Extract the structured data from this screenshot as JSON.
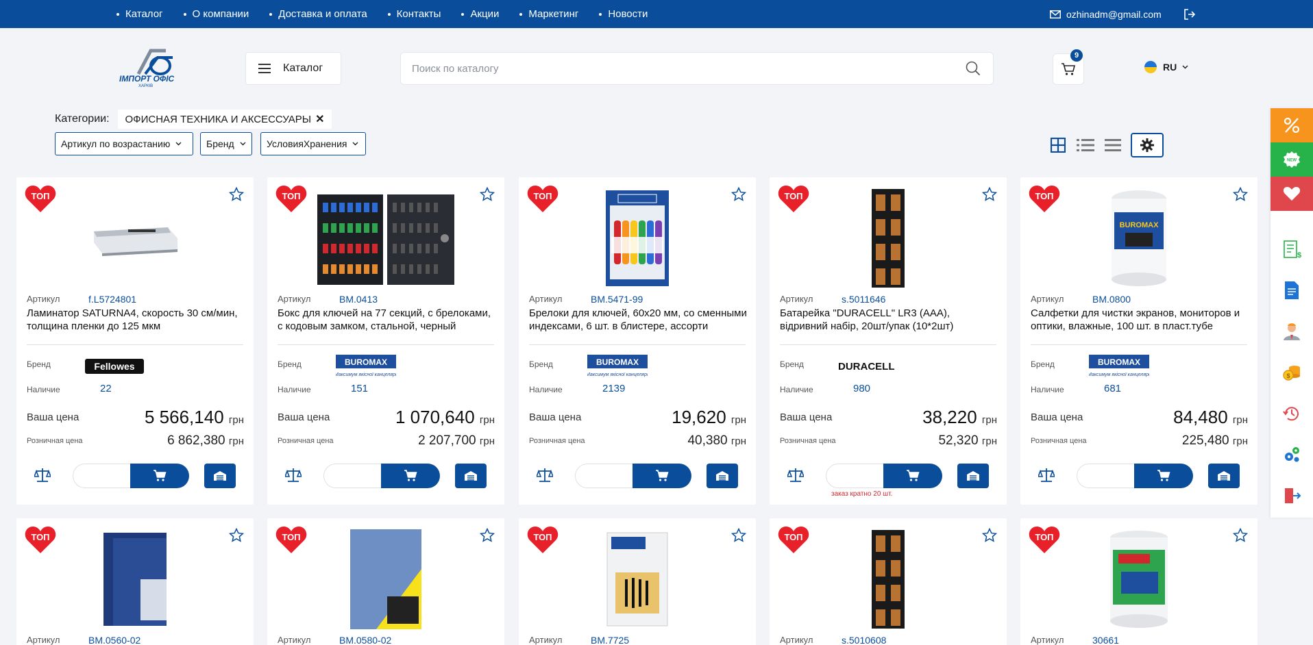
{
  "topnav": {
    "items": [
      "Каталог",
      "О компании",
      "Доставка и оплата",
      "Контакты",
      "Акции",
      "Маркетинг",
      "Новости"
    ],
    "email": "ozhinadm@gmail.com"
  },
  "header": {
    "catalog_label": "Каталог",
    "search_placeholder": "Поиск по каталогу",
    "cart_count": "9",
    "lang": "RU"
  },
  "filters": {
    "categories_label": "Категории:",
    "category_chip": "ОФИСНАЯ ТЕХНИКА И АКСЕССУАРЫ",
    "sort": "Артикул по возрастанию",
    "brand": "Бренд",
    "storage": "УсловияХранения"
  },
  "labels": {
    "top": "ТОП",
    "article": "Артикул",
    "brand": "Бренд",
    "stock": "Наличие",
    "your_price": "Ваша цена",
    "retail_price": "Розничная цена",
    "currency": "грн"
  },
  "products": [
    {
      "article": "f.L5724801",
      "title": "Ламинатор SATURNA4, скорость 30 см/мин, толщина пленки до 125 мкм",
      "brand": "Fellowes",
      "stock": "22",
      "price": "5 566,140",
      "retail": "6 862,380"
    },
    {
      "article": "BM.0413",
      "title": "Бокс для ключей на 77 секций, с брелоками, с кодовым замком, стальной, черный",
      "brand": "BUROMAX",
      "stock": "151",
      "price": "1 070,640",
      "retail": "2 207,700"
    },
    {
      "article": "BM.5471-99",
      "title": "Брелоки для ключей, 60x20 мм, со сменными индексами, 6 шт. в блистере, ассорти",
      "brand": "BUROMAX",
      "stock": "2139",
      "price": "19,620",
      "retail": "40,380"
    },
    {
      "article": "s.5011646",
      "title": "Батарейка \"DURACELL\" LR3 (AAA), відривний набір, 20шт/упак (10*2шт)",
      "brand": "DURACELL",
      "stock": "980",
      "price": "38,220",
      "retail": "52,320",
      "note": "заказ кратно 20 шт."
    },
    {
      "article": "BM.0800",
      "title": "Салфетки для чистки экранов, мониторов и оптики, влажные, 100 шт. в пласт.тубе",
      "brand": "BUROMAX",
      "stock": "681",
      "price": "84,480",
      "retail": "225,480"
    }
  ],
  "products_row2": [
    {
      "article": "BM.0560-02"
    },
    {
      "article": "BM.0580-02"
    },
    {
      "article": "BM.7725"
    },
    {
      "article": "s.5010608"
    },
    {
      "article": "30661"
    }
  ],
  "brand_tagline": "Максимум якісної канцелярії",
  "colors": {
    "brand_blue": "#0a4e9b",
    "top_red": "#e8202a",
    "discount_orange": "#f7941d",
    "new_green": "#27b34a",
    "fav_red": "#e0474c"
  }
}
